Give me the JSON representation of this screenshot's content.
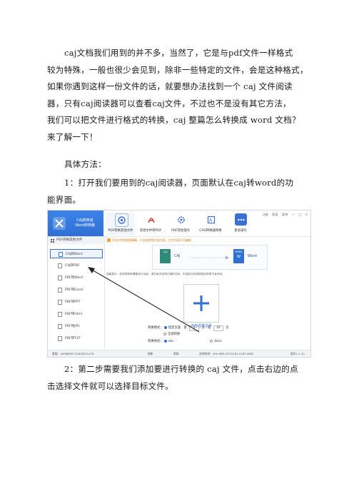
{
  "document": {
    "paragraph1_lines": [
      "caj文档我们用到的并不多，当然了，它是与pdf文件一样格式",
      "较为特殊，一般也很少会见到，除非一些特定的文件，会是这种格式，",
      "如果你遇到这样一份文件的话，就要想办法找到一个 caj 文件阅读",
      "器，只有caj阅读器可以查看caj文件，不过也不是没有其它方法，",
      "我们可以把文件进行格式的转换，caj 整篇怎么转换成 word 文档？",
      "来了解一下！"
    ],
    "method_heading": "具体方法：",
    "step1_lines": [
      "1：打开我们要用到的caj阅读器，页面默认在caj转word的功",
      "能界面。"
    ],
    "step2_lines": [
      "2：第二步需要我们添加要进行转换的 caj 文件，点击右边的点",
      "击选择文件就可以选择目标文件。"
    ]
  },
  "screenshot": {
    "brand_line1": "CAJ转换成",
    "brand_line2": "Word转换器",
    "tools": [
      {
        "label": "PDF转换其他文件",
        "icon": "pdf-convert-icon",
        "color": "#3a6fd8"
      },
      {
        "label": "其他文件转PDF",
        "icon": "adobe-pdf-icon",
        "color": "#e03a2f"
      },
      {
        "label": "PDF其他操作",
        "icon": "gear-icon",
        "color": "#3a6fd8"
      },
      {
        "label": "CAD转换器转换",
        "icon": "cad-icon",
        "color": "#3a6fd8"
      },
      {
        "label": "更多操作",
        "icon": "more-icon",
        "color": "#3a6fd8"
      }
    ],
    "window_controls": [
      "注册",
      "登录",
      "菜单",
      "—",
      "□",
      "×"
    ],
    "sidebar_header": "PDF转换其他文件",
    "sidebar_items": [
      "CAJ转Word",
      "CAJ转PDF",
      "PDF转Word",
      "PDF转Excel",
      "PDF转PPT",
      "PDF转Html",
      "PDF转JPG",
      "PDF转TXT"
    ],
    "notice": "CAJ文件转换更精确，只支持转换页面内容，文字内容不可编辑",
    "flow_left_badge": "CAJ",
    "flow_left_text": "CAJ",
    "flow_right_badge": "WORD",
    "flow_right_text": "Word",
    "tip": "温馨提示：若您想转换需要部分页面，请在每页选择正确的页码，实现部分转换提高效率更节省时间。",
    "add_file_label": "点击选择文件",
    "convert_mode_label": "转换模式：",
    "mode_option1": "指定页面",
    "page_from_label": "第",
    "page_from": "1",
    "page_to_label": "页 - 第",
    "page_to": "10",
    "page_unit": "页",
    "mode_option2": "全部转换",
    "format_label": "转换格式：",
    "format_doc": "doc",
    "format_docx": "docx",
    "status_qq": "客服：4006685572/826231476",
    "status_refresh": "刷新",
    "status_help": "帮助",
    "status_phone": "咨询热线：400-668-5572/181-2187-4682",
    "status_version": "版本1.2.10"
  }
}
